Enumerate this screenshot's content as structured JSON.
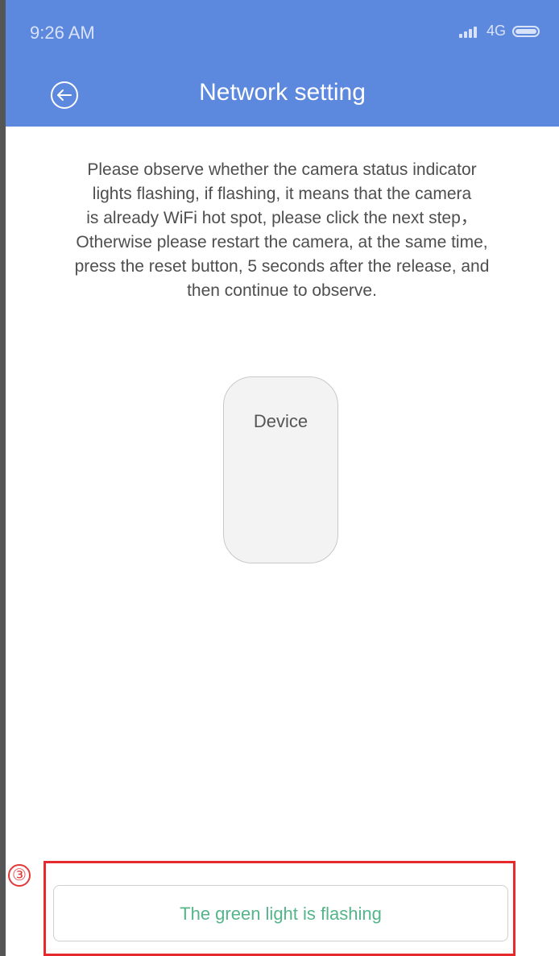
{
  "status_bar": {
    "time": "9:26 AM",
    "network": "4G",
    "icons": [
      "signal-icon",
      "battery-icon"
    ]
  },
  "header": {
    "title": "Network setting",
    "back_icon": "back-arrow-circle-icon"
  },
  "instructions": [
    "Please observe whether the camera status indicator",
    "lights flashing, if flashing, it means that the camera",
    "is already WiFi hot spot, please click the next step，",
    "Otherwise please restart the camera, at the same time,",
    "press the reset button, 5 seconds after the release, and",
    "then continue to observe."
  ],
  "device": {
    "label": "Device"
  },
  "annotation": {
    "number": "③"
  },
  "action": {
    "label": "The green light is flashing"
  },
  "colors": {
    "header_bg": "#5c88de",
    "accent_green": "#55b58a",
    "highlight_red": "#e5292d"
  }
}
